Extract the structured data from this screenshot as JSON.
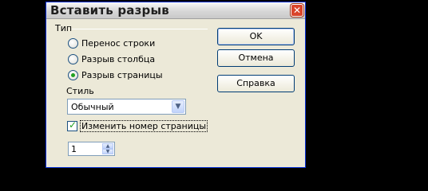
{
  "dialog": {
    "title": "Вставить разрыв",
    "close_icon": "close-icon"
  },
  "type_group": {
    "label": "Тип",
    "options": [
      {
        "label": "Перенос строки",
        "selected": false
      },
      {
        "label": "Разрыв столбца",
        "selected": false
      },
      {
        "label": "Разрыв страницы",
        "selected": true
      }
    ]
  },
  "style": {
    "label": "Стиль",
    "value": "Обычный"
  },
  "change_page_number": {
    "label": "Изменить номер страницы",
    "checked": true
  },
  "page_number": {
    "value": "1"
  },
  "buttons": {
    "ok": "OK",
    "cancel": "Отмена",
    "help": "Справка"
  },
  "colors": {
    "accent": "#0831d9",
    "radio_dot": "#21a121"
  }
}
